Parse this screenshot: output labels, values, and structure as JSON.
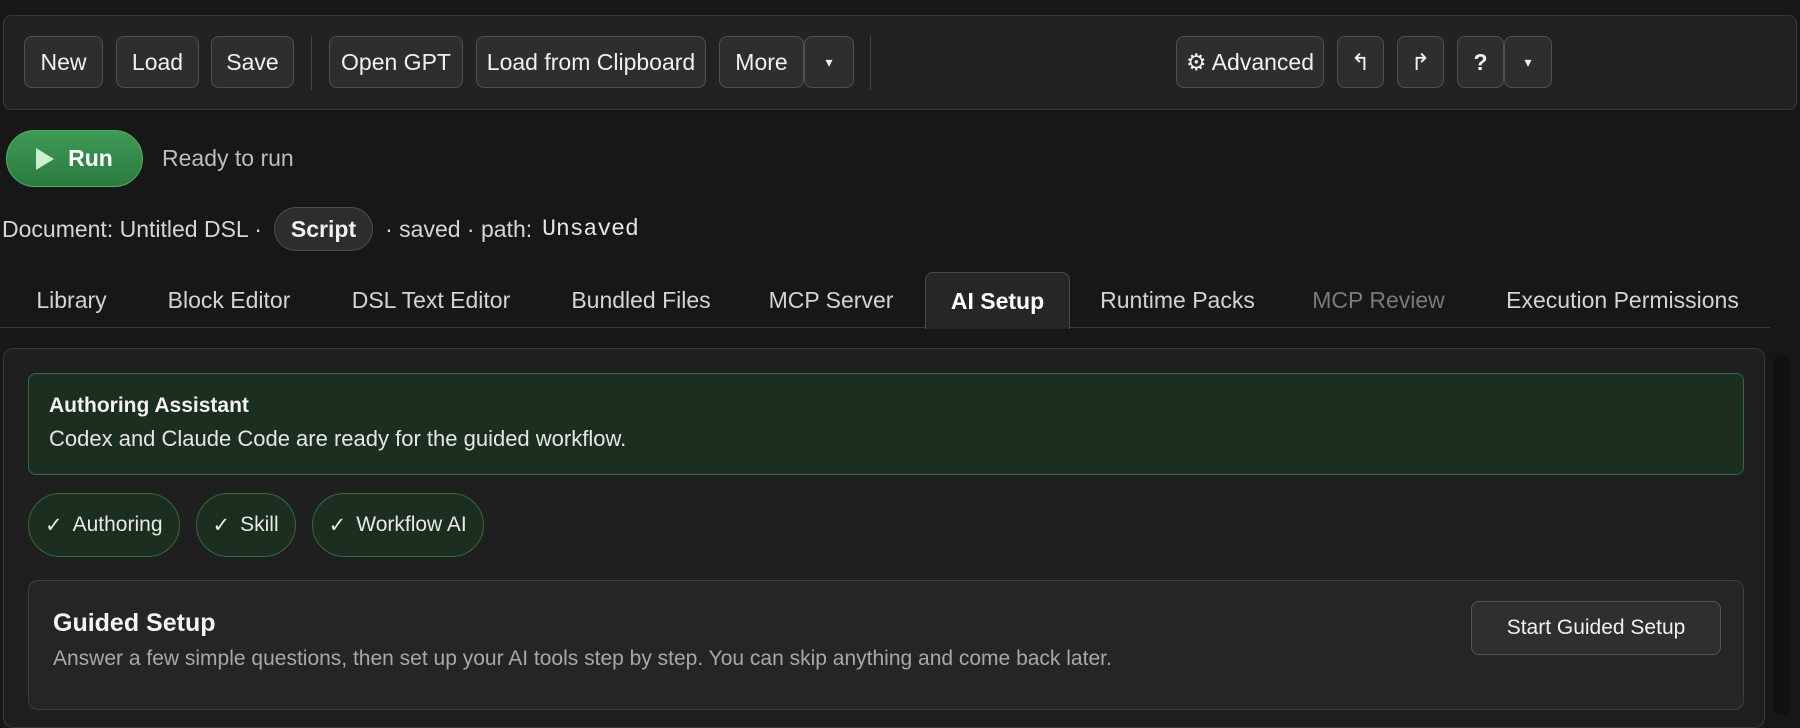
{
  "toolbar": {
    "new": "New",
    "load": "Load",
    "save": "Save",
    "open_gpt": "Open GPT",
    "load_clipboard": "Load from Clipboard",
    "more": "More",
    "dropdown_glyph": "▾",
    "advanced": "⚙ Advanced",
    "undo_glyph": "↰",
    "redo_glyph": "↱",
    "help": "?"
  },
  "run": {
    "label": "Run",
    "status": "Ready to run"
  },
  "document": {
    "prefix": "Document: Untitled DSL ·",
    "type": "Script",
    "suffix": "· saved · path:",
    "path": "Unsaved"
  },
  "tabs": [
    {
      "label": "Library"
    },
    {
      "label": "Block Editor"
    },
    {
      "label": "DSL Text Editor"
    },
    {
      "label": "Bundled Files"
    },
    {
      "label": "MCP Server"
    },
    {
      "label": "AI Setup",
      "active": true
    },
    {
      "label": "Runtime Packs"
    },
    {
      "label": "MCP Review",
      "disabled": true
    },
    {
      "label": "Execution Permissions"
    }
  ],
  "assistant": {
    "title": "Authoring Assistant",
    "text": "Codex and Claude Code are ready for the guided workflow."
  },
  "chips": [
    {
      "label": "Authoring"
    },
    {
      "label": "Skill"
    },
    {
      "label": "Workflow AI"
    }
  ],
  "guided": {
    "title": "Guided Setup",
    "text": "Answer a few simple questions, then set up your AI tools step by step. You can skip anything and come back later.",
    "button": "Start Guided Setup"
  }
}
